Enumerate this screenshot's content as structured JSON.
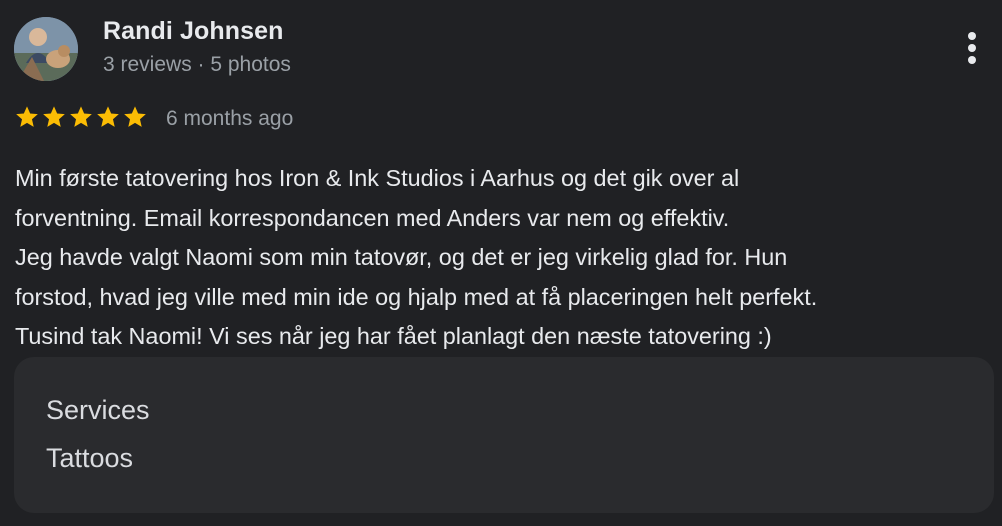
{
  "reviewer": {
    "name": "Randi Johnsen",
    "meta": "3 reviews · 5 photos"
  },
  "rating": {
    "stars": 5,
    "max": 5,
    "star_color": "#fbbc04",
    "time": "6 months ago"
  },
  "review_text": [
    "Min første tatovering hos Iron & Ink Studios i Aarhus og det gik over al",
    "forventning. Email korrespondancen med Anders var nem og effektiv.",
    "Jeg havde valgt Naomi som min tatovør, og det er jeg virkelig glad for. Hun",
    "forstod, hvad jeg ville med min ide og hjalp med at få placeringen helt perfekt.",
    "Tusind tak Naomi! Vi ses når jeg har fået planlagt den næste tatovering :)"
  ],
  "services": {
    "title": "Services",
    "value": "Tattoos"
  },
  "icons": {
    "more": "more-vert-icon",
    "star": "star-icon"
  },
  "colors": {
    "background": "#202124",
    "card": "#2a2b2e",
    "text": "#e8eaed",
    "secondary": "#9aa0a6"
  }
}
